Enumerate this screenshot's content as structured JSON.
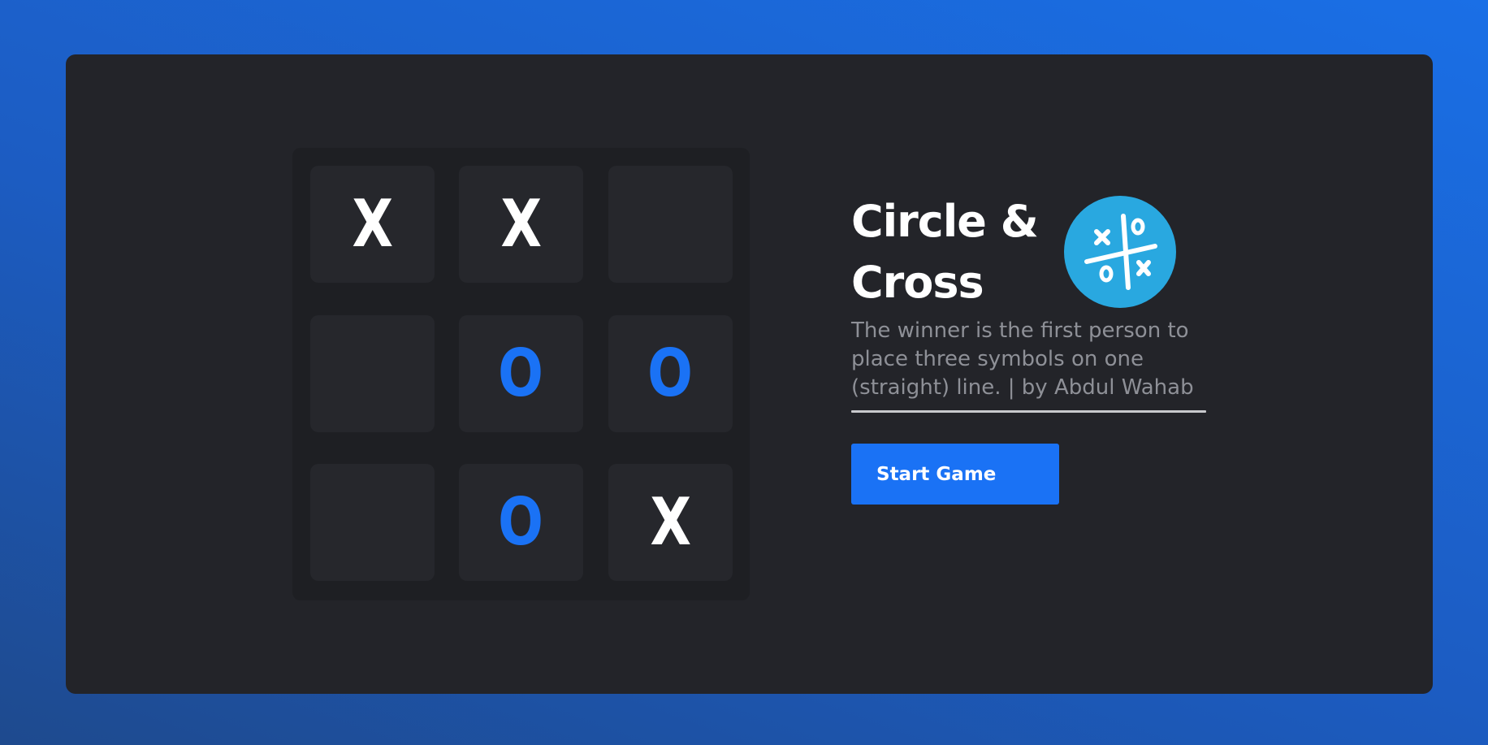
{
  "board": {
    "cells": [
      {
        "mark": "X",
        "player": "x"
      },
      {
        "mark": "X",
        "player": "x"
      },
      {
        "mark": "",
        "player": ""
      },
      {
        "mark": "",
        "player": ""
      },
      {
        "mark": "O",
        "player": "o"
      },
      {
        "mark": "O",
        "player": "o"
      },
      {
        "mark": "",
        "player": ""
      },
      {
        "mark": "O",
        "player": "o"
      },
      {
        "mark": "X",
        "player": "x"
      }
    ]
  },
  "info": {
    "title": "Circle & Cross",
    "description": "The winner is the first person to place three symbols on one (straight) line. | by Abdul Wahab",
    "start_label": "Start Game",
    "logo_icon": "tic-tac-toe-logo-icon"
  },
  "colors": {
    "background_gradient": [
      "#1e4a8e",
      "#1a6fe6"
    ],
    "card": "#232429",
    "board": "#1e1f23",
    "cell": "#26272c",
    "x_mark": "#ffffff",
    "o_mark": "#1a72f5",
    "accent": "#1a72f5",
    "logo": "#29a8e0",
    "description_text": "#8e9097"
  }
}
